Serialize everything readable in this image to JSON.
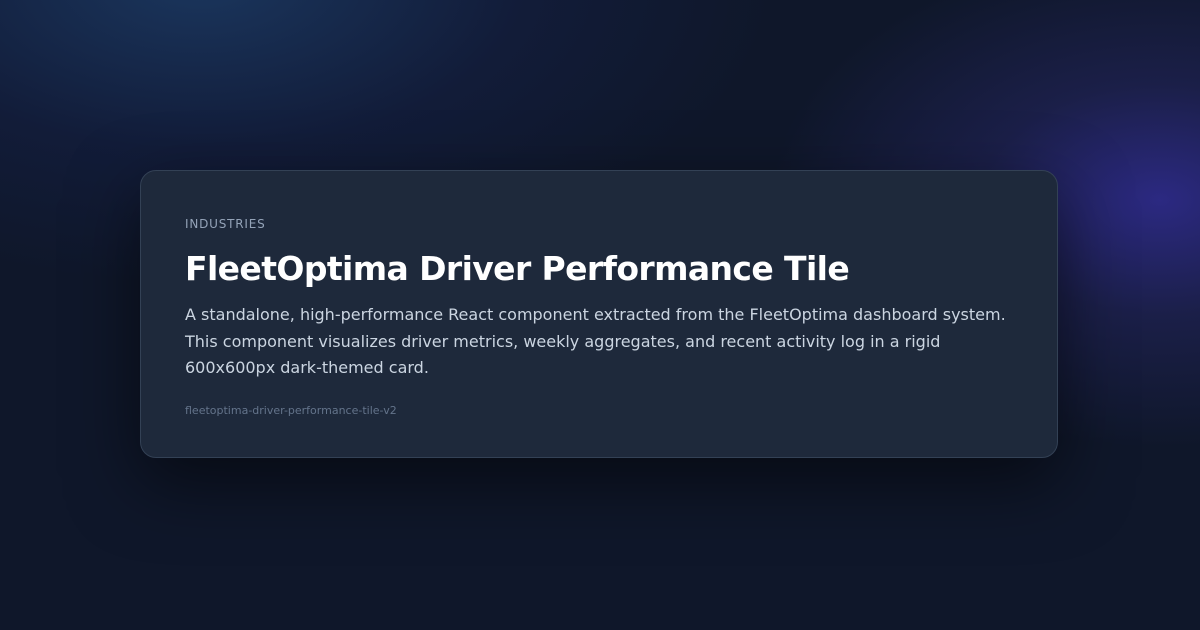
{
  "card": {
    "category": "INDUSTRIES",
    "title": "FleetOptima Driver Performance Tile",
    "description": "A standalone, high-performance React component extracted from the FleetOptima dashboard system. This component visualizes driver metrics, weekly aggregates, and recent activity log in a rigid 600x600px dark-themed card.",
    "slug": "fleetoptima-driver-performance-tile-v2"
  },
  "colors": {
    "background": "#0f172a",
    "card_background": "#1e293b",
    "card_border": "#334155",
    "title_text": "#ffffff",
    "body_text": "#cbd5e1",
    "muted_text": "#94a3b8",
    "slug_text": "#64748b",
    "glow_purple": "#4338ca",
    "glow_blue": "#1e406e"
  }
}
